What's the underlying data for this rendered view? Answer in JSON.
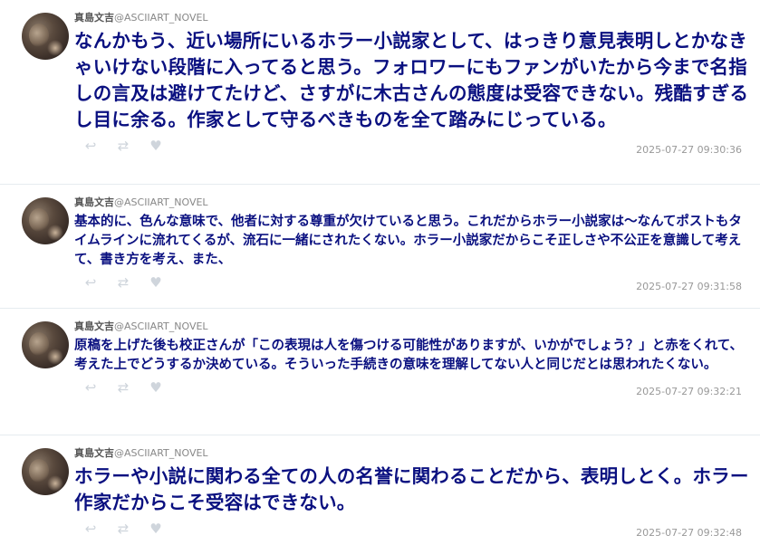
{
  "posts": [
    {
      "name": "真島文吉",
      "handle": "@ASCIIART_NOVEL",
      "text": "なんかもう、近い場所にいるホラー小説家として、はっきり意見表明しとかなきゃいけない段階に入ってると思う。フォロワーにもファンがいたから今まで名指しの言及は避けてたけど、さすがに木古さんの態度は受容できない。残酷すぎるし目に余る。作家として守るべきものを全て踏みにじっている。",
      "time": "2025-07-27 09:30:36"
    },
    {
      "name": "真島文吉",
      "handle": "@ASCIIART_NOVEL",
      "text": "基本的に、色んな意味で、他者に対する尊重が欠けていると思う。これだからホラー小説家は〜なんてポストもタイムラインに流れてくるが、流石に一緒にされたくない。ホラー小説家だからこそ正しさや不公正を意識して考えて、書き方を考え、また、",
      "time": "2025-07-27 09:31:58"
    },
    {
      "name": "真島文吉",
      "handle": "@ASCIIART_NOVEL",
      "text": "原稿を上げた後も校正さんが「この表現は人を傷つける可能性がありますが、いかがでしょう？」と赤をくれて、考えた上でどうするか決めている。そういった手続きの意味を理解してない人と同じだとは思われたくない。",
      "time": "2025-07-27 09:32:21"
    },
    {
      "name": "真島文吉",
      "handle": "@ASCIIART_NOVEL",
      "text": "ホラーや小説に関わる全ての人の名誉に関わることだから、表明しとく。ホラー作家だからこそ受容はできない。",
      "time": "2025-07-27 09:32:48"
    }
  ],
  "icons": {
    "reply": "reply-icon",
    "repost": "repost-icon",
    "like": "heart-icon"
  },
  "colors": {
    "text": "#0a1080",
    "meta": "#888888",
    "icon": "#cfd5dc",
    "divider": "#e6ecf0"
  }
}
